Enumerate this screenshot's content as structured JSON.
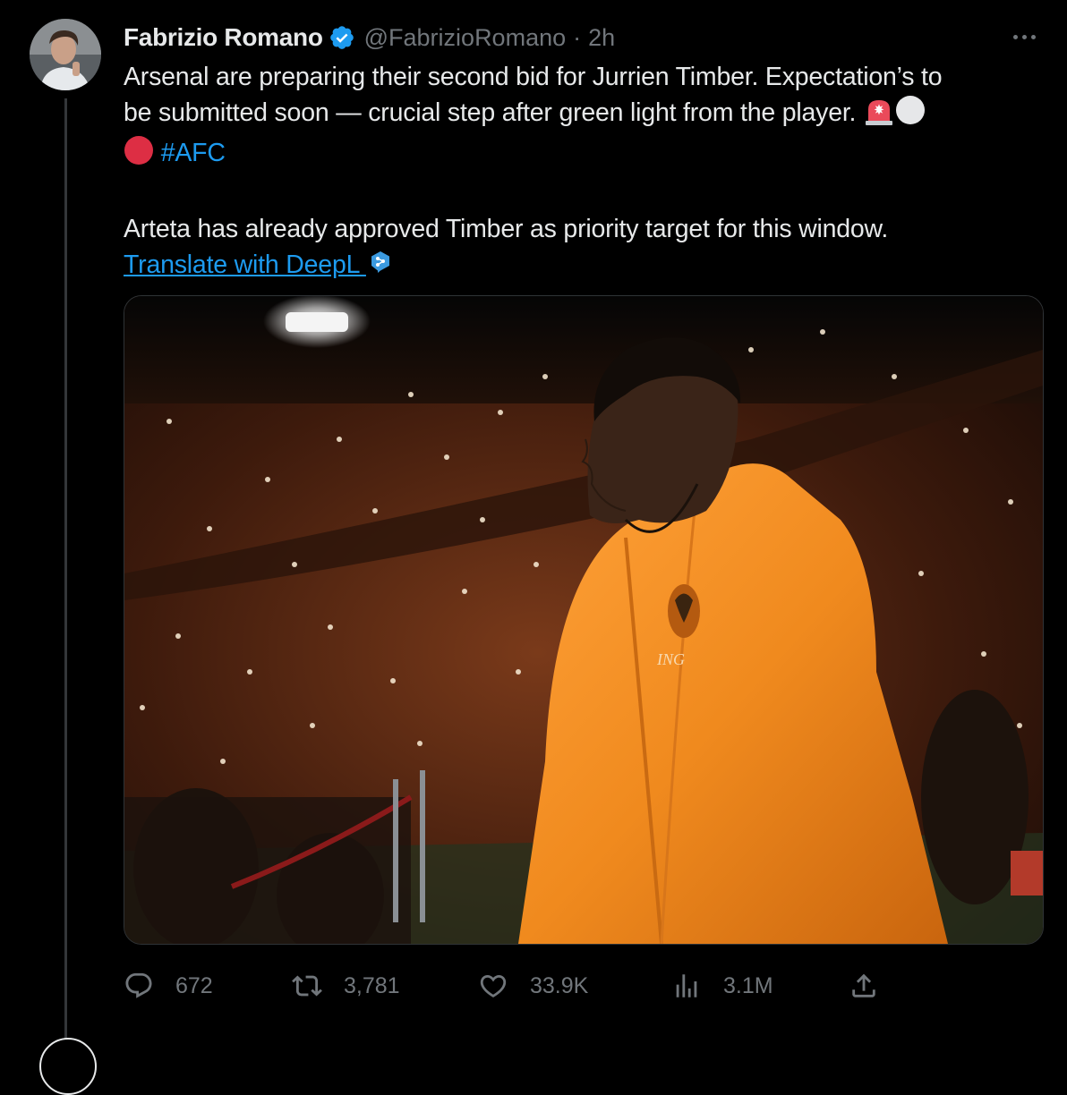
{
  "tweet": {
    "author": {
      "name": "Fabrizio Romano",
      "handle": "@FabrizioRomano",
      "verified": true,
      "avatar_icon": "profile-photo"
    },
    "separator": "·",
    "time": "2h",
    "more_icon": "more-horizontal-icon",
    "text": {
      "line1": "Arsenal are preparing their second bid for Jurrien Timber. Expectation’s to",
      "line2": "be submitted soon — crucial step after green light from the player.",
      "emoji1": "🚨",
      "emoji2": "⚪️",
      "emoji3": "🔴",
      "hashtag": "#AFC",
      "paragraph2": "Arteta has already approved Timber as priority target for this window.",
      "translate_link": "Translate with DeepL "
    },
    "media": {
      "description_icon": "photo-player-orange-jacket",
      "jacket_logo": "ING"
    },
    "actions": {
      "replies": "672",
      "retweets": "3,781",
      "likes": "33.9K",
      "views": "3.1M"
    }
  },
  "colors": {
    "background": "#000000",
    "text": "#e7e9ea",
    "secondary": "#71767b",
    "link": "#1d9bf0",
    "verified": "#1d9bf0",
    "jacket": "#f08a1e"
  }
}
